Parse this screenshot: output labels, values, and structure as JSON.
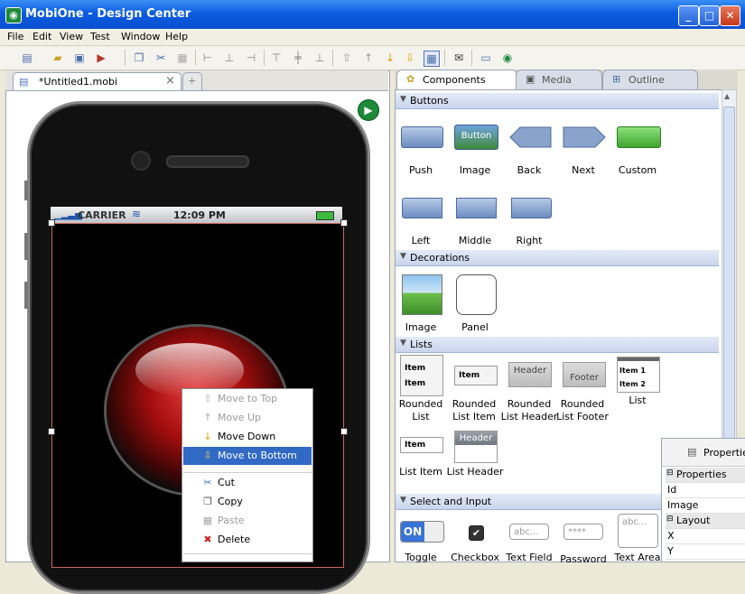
{
  "window": {
    "title": "MobiOne - Design Center"
  },
  "menu": [
    "File",
    "Edit",
    "View",
    "Test",
    "Window",
    "Help"
  ],
  "editor": {
    "tab_label": "*Untitled1.mobi",
    "tab_close": "×"
  },
  "phone_status": {
    "carrier": "CARRIER",
    "time": "12:09 PM"
  },
  "context_menu": [
    {
      "label": "Move to Top",
      "state": "disabled",
      "icon": "arrow-up-icon"
    },
    {
      "label": "Move Up",
      "state": "disabled",
      "icon": "arrow-up-icon"
    },
    {
      "label": "Move Down",
      "state": "enabled",
      "icon": "arrow-down-icon"
    },
    {
      "label": "Move to Bottom",
      "state": "selected",
      "icon": "arrow-bottom-icon"
    },
    {
      "label": "Cut",
      "state": "enabled",
      "icon": "scissors-icon"
    },
    {
      "label": "Copy",
      "state": "enabled",
      "icon": "copy-icon"
    },
    {
      "label": "Paste",
      "state": "disabled",
      "icon": "paste-icon"
    },
    {
      "label": "Delete",
      "state": "enabled",
      "icon": "delete-icon"
    }
  ],
  "palette_tabs": [
    "Components",
    "Media",
    "Outline"
  ],
  "sections": {
    "buttons": "Buttons",
    "decorations": "Decorations",
    "lists": "Lists",
    "select_input": "Select and Input"
  },
  "buttons": {
    "push": "Push",
    "image": "Image",
    "image_caption": "Button",
    "back": "Back",
    "next": "Next",
    "custom": "Custom",
    "left": "Left",
    "middle": "Middle",
    "right": "Right"
  },
  "decorations": {
    "image": "Image",
    "panel": "Panel"
  },
  "lists": {
    "rounded_list_1": "Rounded",
    "rounded_list_2": "List",
    "rounded_item_1": "Rounded",
    "rounded_item_2": "List Item",
    "rounded_header_1": "Rounded",
    "rounded_header_2": "List Header",
    "rounded_footer_1": "Rounded",
    "rounded_footer_2": "List Footer",
    "list": "List",
    "list_item": "List Item",
    "list_header": "List Header",
    "item": "Item",
    "item1": "Item 1",
    "item2": "Item 2",
    "header": "Header",
    "footer": "Footer"
  },
  "inputs": {
    "toggle": "Toggle",
    "toggle_on": "ON",
    "checkbox": "Checkbox",
    "text_field": "Text Field",
    "text_field_ph": "abc...",
    "password": "Password",
    "password_ph": "****",
    "text_area": "Text Area",
    "text_area_ph": "abc..."
  },
  "properties": {
    "title": "Properties",
    "rows": [
      {
        "label": "Properties",
        "group": true
      },
      {
        "label": "Id",
        "group": false
      },
      {
        "label": "Image",
        "group": false
      },
      {
        "label": "Layout",
        "group": true
      },
      {
        "label": "X",
        "group": false
      },
      {
        "label": "Y",
        "group": false
      }
    ]
  }
}
